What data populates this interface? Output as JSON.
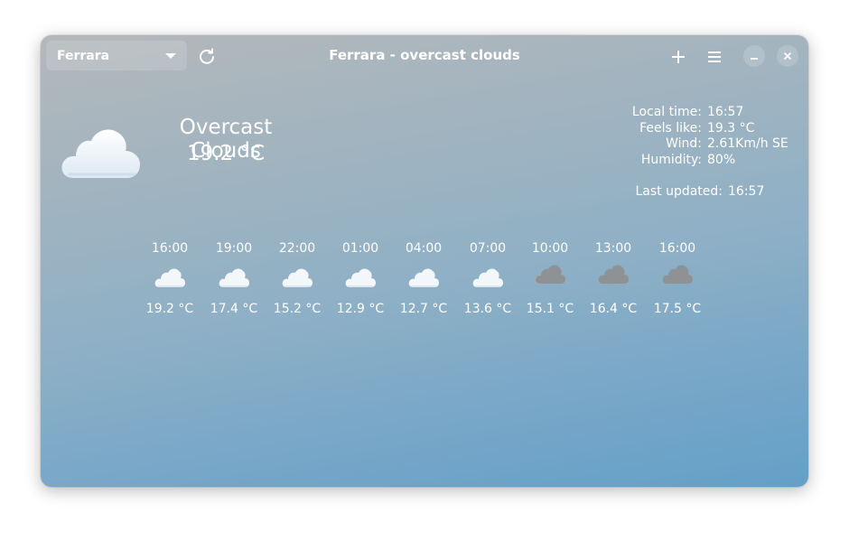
{
  "window": {
    "title": "Ferrara - overcast clouds"
  },
  "header": {
    "location": "Ferrara",
    "refresh_icon": "refresh-icon",
    "add_icon": "plus-icon",
    "menu_icon": "hamburger-menu-icon",
    "minimize_icon": "minimize-icon",
    "close_icon": "close-icon"
  },
  "current": {
    "icon": "cloud-icon",
    "condition": "Overcast Clouds",
    "temperature": "19.2 °C"
  },
  "details": {
    "local_time_label": "Local time:",
    "local_time": "16:57",
    "feels_like_label": "Feels like:",
    "feels_like": "19.3 °C",
    "wind_label": "Wind:",
    "wind": "2.61Km/h SE",
    "humidity_label": "Humidity:",
    "humidity": "80%",
    "last_updated_label": "Last updated:",
    "last_updated": "16:57"
  },
  "forecast": [
    {
      "time": "16:00",
      "temp": "19.2 °C",
      "icon": "cloud-icon"
    },
    {
      "time": "19:00",
      "temp": "17.4 °C",
      "icon": "cloud-icon"
    },
    {
      "time": "22:00",
      "temp": "15.2 °C",
      "icon": "cloud-icon"
    },
    {
      "time": "01:00",
      "temp": "12.9 °C",
      "icon": "cloud-icon"
    },
    {
      "time": "04:00",
      "temp": "12.7 °C",
      "icon": "cloud-icon"
    },
    {
      "time": "07:00",
      "temp": "13.6 °C",
      "icon": "cloud-icon"
    },
    {
      "time": "10:00",
      "temp": "15.1 °C",
      "icon": "rain-cloud-icon"
    },
    {
      "time": "13:00",
      "temp": "16.4 °C",
      "icon": "dark-cloud-icon"
    },
    {
      "time": "16:00",
      "temp": "17.5 °C",
      "icon": "dark-cloud-icon"
    }
  ],
  "colors": {
    "gradient_top": "#b4b8bb",
    "gradient_bottom": "#64a0c8",
    "text": "#ffffff",
    "light_cloud": "#f4f7fa",
    "dark_cloud": "#8f9295"
  }
}
